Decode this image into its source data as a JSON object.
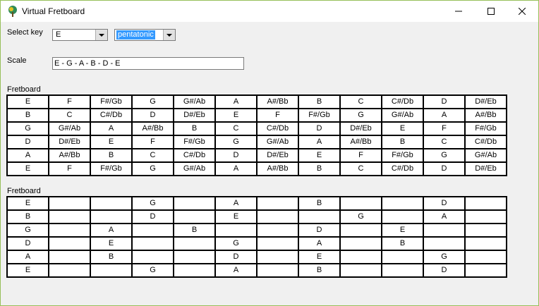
{
  "window": {
    "title": "Virtual Fretboard"
  },
  "controls": {
    "key_label": "Select key",
    "key_value": "E",
    "scale_type_value": "pentatonic",
    "scale_label": "Scale",
    "scale_value": "E - G - A - B - D - E"
  },
  "fretboard1": {
    "label": "Fretboard",
    "rows": [
      [
        "E",
        "F",
        "F#/Gb",
        "G",
        "G#/Ab",
        "A",
        "A#/Bb",
        "B",
        "C",
        "C#/Db",
        "D",
        "D#/Eb"
      ],
      [
        "B",
        "C",
        "C#/Db",
        "D",
        "D#/Eb",
        "E",
        "F",
        "F#/Gb",
        "G",
        "G#/Ab",
        "A",
        "A#/Bb"
      ],
      [
        "G",
        "G#/Ab",
        "A",
        "A#/Bb",
        "B",
        "C",
        "C#/Db",
        "D",
        "D#/Eb",
        "E",
        "F",
        "F#/Gb"
      ],
      [
        "D",
        "D#/Eb",
        "E",
        "F",
        "F#/Gb",
        "G",
        "G#/Ab",
        "A",
        "A#/Bb",
        "B",
        "C",
        "C#/Db"
      ],
      [
        "A",
        "A#/Bb",
        "B",
        "C",
        "C#/Db",
        "D",
        "D#/Eb",
        "E",
        "F",
        "F#/Gb",
        "G",
        "G#/Ab"
      ],
      [
        "E",
        "F",
        "F#/Gb",
        "G",
        "G#/Ab",
        "A",
        "A#/Bb",
        "B",
        "C",
        "C#/Db",
        "D",
        "D#/Eb"
      ]
    ]
  },
  "fretboard2": {
    "label": "Fretboard",
    "rows": [
      [
        "E",
        "",
        "",
        "G",
        "",
        "A",
        "",
        "B",
        "",
        "",
        "D",
        ""
      ],
      [
        "B",
        "",
        "",
        "D",
        "",
        "E",
        "",
        "",
        "G",
        "",
        "A",
        ""
      ],
      [
        "G",
        "",
        "A",
        "",
        "B",
        "",
        "",
        "D",
        "",
        "E",
        "",
        ""
      ],
      [
        "D",
        "",
        "E",
        "",
        "",
        "G",
        "",
        "A",
        "",
        "B",
        "",
        ""
      ],
      [
        "A",
        "",
        "B",
        "",
        "",
        "D",
        "",
        "E",
        "",
        "",
        "G",
        ""
      ],
      [
        "E",
        "",
        "",
        "G",
        "",
        "A",
        "",
        "B",
        "",
        "",
        "D",
        ""
      ]
    ]
  }
}
